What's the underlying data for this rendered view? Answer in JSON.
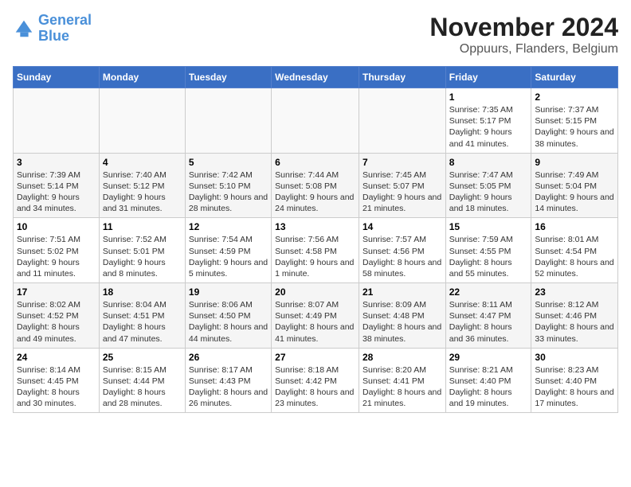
{
  "logo": {
    "line1": "General",
    "line2": "Blue"
  },
  "title": "November 2024",
  "subtitle": "Oppuurs, Flanders, Belgium",
  "days_of_week": [
    "Sunday",
    "Monday",
    "Tuesday",
    "Wednesday",
    "Thursday",
    "Friday",
    "Saturday"
  ],
  "weeks": [
    [
      {
        "day": "",
        "info": ""
      },
      {
        "day": "",
        "info": ""
      },
      {
        "day": "",
        "info": ""
      },
      {
        "day": "",
        "info": ""
      },
      {
        "day": "",
        "info": ""
      },
      {
        "day": "1",
        "info": "Sunrise: 7:35 AM\nSunset: 5:17 PM\nDaylight: 9 hours and 41 minutes."
      },
      {
        "day": "2",
        "info": "Sunrise: 7:37 AM\nSunset: 5:15 PM\nDaylight: 9 hours and 38 minutes."
      }
    ],
    [
      {
        "day": "3",
        "info": "Sunrise: 7:39 AM\nSunset: 5:14 PM\nDaylight: 9 hours and 34 minutes."
      },
      {
        "day": "4",
        "info": "Sunrise: 7:40 AM\nSunset: 5:12 PM\nDaylight: 9 hours and 31 minutes."
      },
      {
        "day": "5",
        "info": "Sunrise: 7:42 AM\nSunset: 5:10 PM\nDaylight: 9 hours and 28 minutes."
      },
      {
        "day": "6",
        "info": "Sunrise: 7:44 AM\nSunset: 5:08 PM\nDaylight: 9 hours and 24 minutes."
      },
      {
        "day": "7",
        "info": "Sunrise: 7:45 AM\nSunset: 5:07 PM\nDaylight: 9 hours and 21 minutes."
      },
      {
        "day": "8",
        "info": "Sunrise: 7:47 AM\nSunset: 5:05 PM\nDaylight: 9 hours and 18 minutes."
      },
      {
        "day": "9",
        "info": "Sunrise: 7:49 AM\nSunset: 5:04 PM\nDaylight: 9 hours and 14 minutes."
      }
    ],
    [
      {
        "day": "10",
        "info": "Sunrise: 7:51 AM\nSunset: 5:02 PM\nDaylight: 9 hours and 11 minutes."
      },
      {
        "day": "11",
        "info": "Sunrise: 7:52 AM\nSunset: 5:01 PM\nDaylight: 9 hours and 8 minutes."
      },
      {
        "day": "12",
        "info": "Sunrise: 7:54 AM\nSunset: 4:59 PM\nDaylight: 9 hours and 5 minutes."
      },
      {
        "day": "13",
        "info": "Sunrise: 7:56 AM\nSunset: 4:58 PM\nDaylight: 9 hours and 1 minute."
      },
      {
        "day": "14",
        "info": "Sunrise: 7:57 AM\nSunset: 4:56 PM\nDaylight: 8 hours and 58 minutes."
      },
      {
        "day": "15",
        "info": "Sunrise: 7:59 AM\nSunset: 4:55 PM\nDaylight: 8 hours and 55 minutes."
      },
      {
        "day": "16",
        "info": "Sunrise: 8:01 AM\nSunset: 4:54 PM\nDaylight: 8 hours and 52 minutes."
      }
    ],
    [
      {
        "day": "17",
        "info": "Sunrise: 8:02 AM\nSunset: 4:52 PM\nDaylight: 8 hours and 49 minutes."
      },
      {
        "day": "18",
        "info": "Sunrise: 8:04 AM\nSunset: 4:51 PM\nDaylight: 8 hours and 47 minutes."
      },
      {
        "day": "19",
        "info": "Sunrise: 8:06 AM\nSunset: 4:50 PM\nDaylight: 8 hours and 44 minutes."
      },
      {
        "day": "20",
        "info": "Sunrise: 8:07 AM\nSunset: 4:49 PM\nDaylight: 8 hours and 41 minutes."
      },
      {
        "day": "21",
        "info": "Sunrise: 8:09 AM\nSunset: 4:48 PM\nDaylight: 8 hours and 38 minutes."
      },
      {
        "day": "22",
        "info": "Sunrise: 8:11 AM\nSunset: 4:47 PM\nDaylight: 8 hours and 36 minutes."
      },
      {
        "day": "23",
        "info": "Sunrise: 8:12 AM\nSunset: 4:46 PM\nDaylight: 8 hours and 33 minutes."
      }
    ],
    [
      {
        "day": "24",
        "info": "Sunrise: 8:14 AM\nSunset: 4:45 PM\nDaylight: 8 hours and 30 minutes."
      },
      {
        "day": "25",
        "info": "Sunrise: 8:15 AM\nSunset: 4:44 PM\nDaylight: 8 hours and 28 minutes."
      },
      {
        "day": "26",
        "info": "Sunrise: 8:17 AM\nSunset: 4:43 PM\nDaylight: 8 hours and 26 minutes."
      },
      {
        "day": "27",
        "info": "Sunrise: 8:18 AM\nSunset: 4:42 PM\nDaylight: 8 hours and 23 minutes."
      },
      {
        "day": "28",
        "info": "Sunrise: 8:20 AM\nSunset: 4:41 PM\nDaylight: 8 hours and 21 minutes."
      },
      {
        "day": "29",
        "info": "Sunrise: 8:21 AM\nSunset: 4:40 PM\nDaylight: 8 hours and 19 minutes."
      },
      {
        "day": "30",
        "info": "Sunrise: 8:23 AM\nSunset: 4:40 PM\nDaylight: 8 hours and 17 minutes."
      }
    ]
  ]
}
